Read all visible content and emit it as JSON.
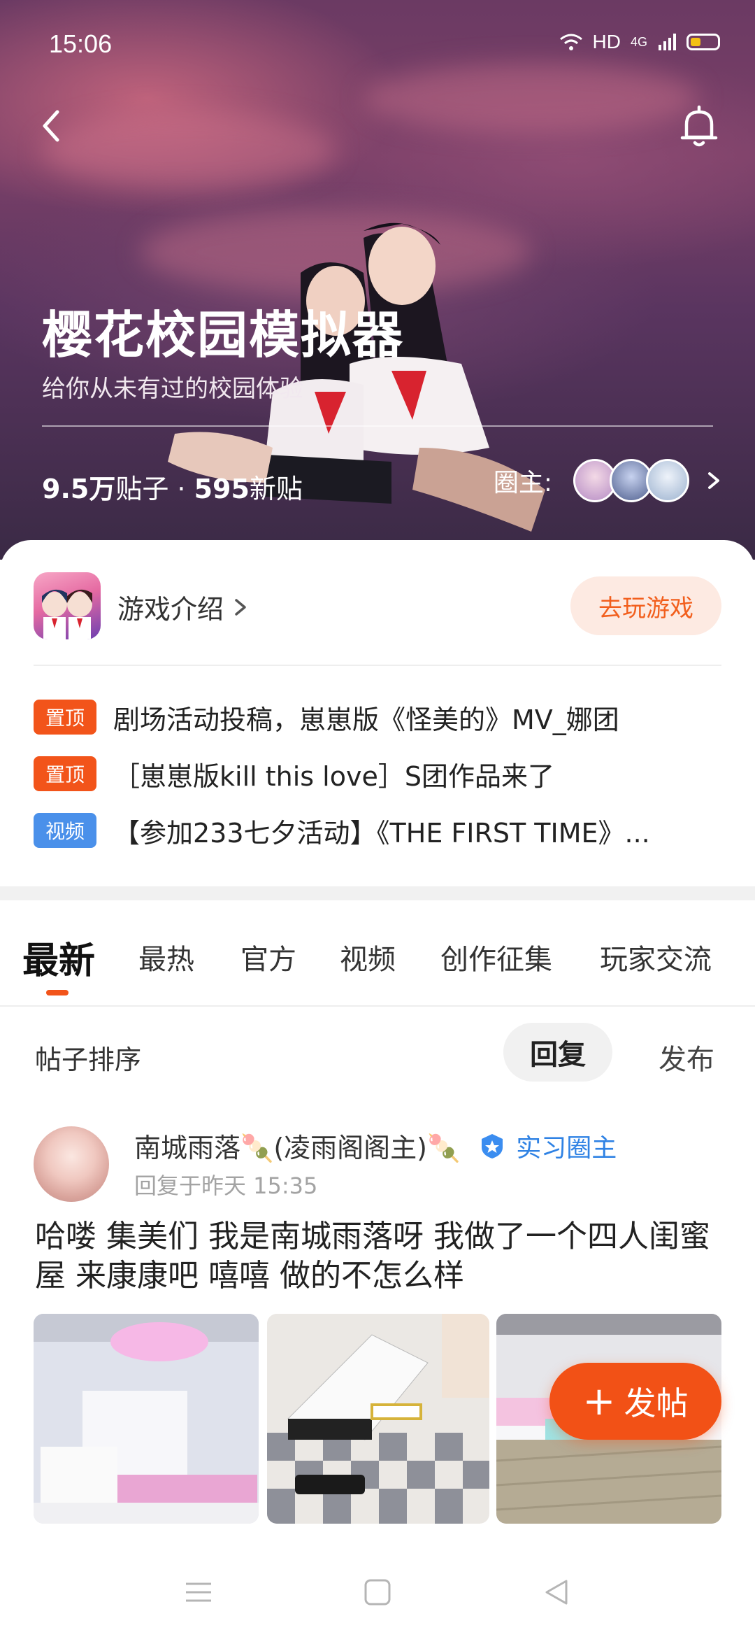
{
  "status_bar": {
    "time": "15:06",
    "network": "HD",
    "signal": "4G"
  },
  "hero": {
    "title": "樱花校园模拟器",
    "subtitle": "给你从未有过的校园体验",
    "posts_count": "9.5万",
    "posts_label": "贴子",
    "separator": " · ",
    "new_count": "595",
    "new_label": "新贴",
    "owners_label": "圈主:"
  },
  "game": {
    "intro_label": "游戏介绍",
    "play_button": "去玩游戏"
  },
  "pinned": [
    {
      "tag": "置顶",
      "tag_type": "pin",
      "title": "剧场活动投稿，崽崽版《怪美的》MV_娜团"
    },
    {
      "tag": "置顶",
      "tag_type": "pin",
      "title": "［崽崽版kill this love］S团作品来了"
    },
    {
      "tag": "视频",
      "tag_type": "video",
      "title": "【参加233七夕活动】《THE FIRST TIME》..."
    }
  ],
  "tabs": [
    "最新",
    "最热",
    "官方",
    "视频",
    "创作征集",
    "玩家交流"
  ],
  "sort": {
    "label": "帖子排序",
    "reply": "回复",
    "publish": "发布"
  },
  "post": {
    "author": "南城雨落🍡(凌雨阁阁主)🍡",
    "badge": "实习圈主",
    "time": "回复于昨天 15:35",
    "text": "哈喽 集美们 我是南城雨落呀 我做了一个四人闺蜜屋 来康康吧 嘻嘻 做的不怎么样"
  },
  "fab": {
    "plus": "+",
    "label": "发帖"
  },
  "colors": {
    "accent": "#f2541a",
    "video_tag": "#4a90ea",
    "badge_blue": "#2f82e4"
  },
  "icons": [
    "back-icon",
    "bell-icon",
    "chevron-right-icon",
    "shield-badge-icon",
    "menu-icon",
    "home-icon",
    "back-triangle-icon"
  ]
}
